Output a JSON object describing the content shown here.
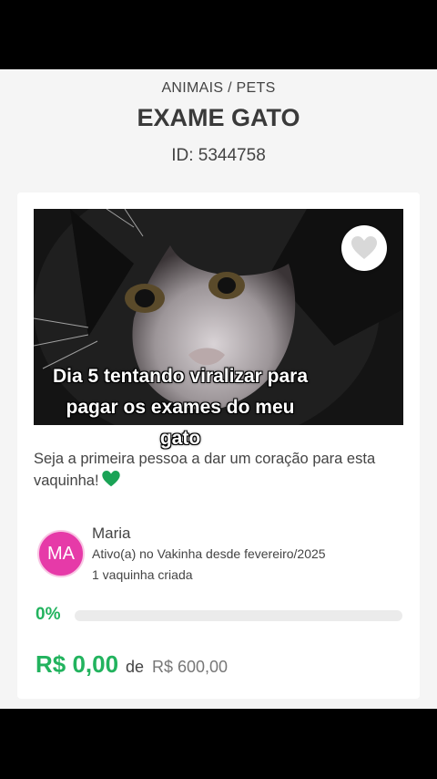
{
  "header": {
    "category": "ANIMAIS / PETS",
    "title": "EXAME GATO",
    "id_text": "ID: 5344758"
  },
  "campaign": {
    "image_caption_lines": [
      "Dia 5 tentando viralizar para",
      "pagar os exames do meu",
      "gato"
    ],
    "hearts_text": "Seja a primeira pessoa a dar um coração para esta vaquinha!",
    "favorite_icon": "heart-icon"
  },
  "owner": {
    "initials": "MA",
    "name": "Maria",
    "since": "Ativo(a) no Vakinha desde fevereiro/2025",
    "count": "1 vaquinha criada"
  },
  "progress": {
    "percent_label": "0%",
    "fraction": 0
  },
  "funding": {
    "raised": "R$ 0,00",
    "of_label": "de",
    "goal": "R$ 600,00"
  },
  "colors": {
    "accent_green": "#22b35e",
    "avatar_pink": "#e63aa8"
  }
}
